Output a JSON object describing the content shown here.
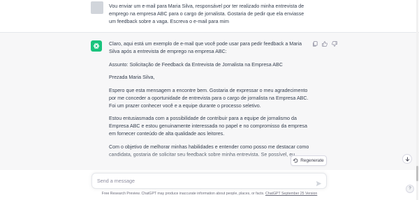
{
  "conversation": {
    "user_message": "Vou enviar um e-mail para Maria Silva, responsável por ter realizado minha entrevista de emprego na empresa ABC para o cargo de jornalista. Gostaria de pedir que ela enviasse um feedback sobre a vaga. Escreva o e-mail para mim",
    "assistant_paragraphs": [
      "Claro, aqui está um exemplo de e-mail que você pode usar para pedir feedback a Maria Silva após a entrevista de emprego na empresa ABC:",
      "Assunto: Solicitação de Feedback da Entrevista de Jornalista na Empresa ABC",
      "Prezada Maria Silva,",
      "Espero que esta mensagem a encontre bem. Gostaria de expressar o meu agradecimento por me conceder a oportunidade de entrevista para o cargo de jornalista na Empresa ABC. Foi um prazer conhecer você e a equipe durante o processo seletivo.",
      "Estou entusiasmada com a possibilidade de contribuir para a equipe de jornalismo da Empresa ABC e estou genuinamente interessada no papel e no compromisso da empresa em fornecer conteúdo de alta qualidade aos leitores.",
      "Com o objetivo de melhorar minhas habilidades e entender como posso me destacar como candidata, gostaria de solicitar seu feedback sobre minha entrevista. Se possível, eu"
    ]
  },
  "actions": {
    "regenerate_label": "Regenerate"
  },
  "composer": {
    "placeholder": "Send a message"
  },
  "footer": {
    "text": "Free Research Preview. ChatGPT may produce inaccurate information about people, places, or facts. ",
    "link_text": "ChatGPT September 25 Version"
  },
  "help": {
    "label": "?"
  },
  "colors": {
    "assistant_avatar": "#19c37d",
    "assistant_background": "#f7f7f8",
    "user_avatar": "#d1d5db"
  },
  "icons": [
    "sidebar-toggle-icon",
    "openai-logo-icon",
    "copy-icon",
    "thumbs-up-icon",
    "thumbs-down-icon",
    "regenerate-icon",
    "arrow-down-icon",
    "send-icon"
  ]
}
